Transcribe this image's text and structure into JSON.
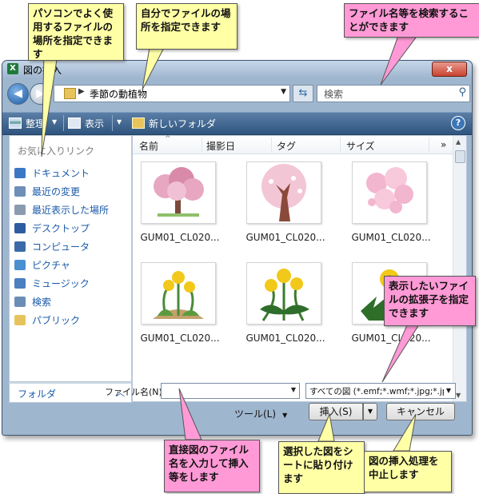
{
  "window": {
    "title": "図の挿入",
    "app_icon": "X",
    "close_label": "x",
    "address": {
      "path": "季節の動植物",
      "separator": "▶"
    },
    "search": {
      "placeholder": "検索"
    },
    "toolbar": {
      "organize_label": "整理",
      "views_label": "表示",
      "new_folder_label": "新しいフォルダ",
      "help_label": "?"
    },
    "favorites": {
      "heading": "お気に入りリンク",
      "items": [
        {
          "label": "ドキュメント",
          "icon": "documents-icon",
          "color": "#3a78c4"
        },
        {
          "label": "最近の変更",
          "icon": "recent-changes-icon",
          "color": "#6d8fb8"
        },
        {
          "label": "最近表示した場所",
          "icon": "recent-places-icon",
          "color": "#8a9bb0"
        },
        {
          "label": "デスクトップ",
          "icon": "desktop-icon",
          "color": "#2d5da0"
        },
        {
          "label": "コンピュータ",
          "icon": "computer-icon",
          "color": "#3c6aa8"
        },
        {
          "label": "ピクチャ",
          "icon": "pictures-icon",
          "color": "#4a8fd0"
        },
        {
          "label": "ミュージック",
          "icon": "music-icon",
          "color": "#4a7fc0"
        },
        {
          "label": "検索",
          "icon": "search-folder-icon",
          "color": "#6b8db5"
        },
        {
          "label": "パブリック",
          "icon": "public-folder-icon",
          "color": "#e7c45b"
        }
      ],
      "folders_label": "フォルダ",
      "folders_chevron": "︿"
    },
    "columns": [
      "名前",
      "撮影日",
      "タグ",
      "サイズ"
    ],
    "columns_more": "»",
    "files": [
      {
        "label": "GUM01_CL020...",
        "icon": "cherry-tree-clipart"
      },
      {
        "label": "GUM01_CL020...",
        "icon": "cherry-tree-pink-clipart"
      },
      {
        "label": "GUM01_CL020...",
        "icon": "cherry-blossom-clipart"
      },
      {
        "label": "GUM01_CL020...",
        "icon": "dandelion-yellow-clipart"
      },
      {
        "label": "GUM01_CL020...",
        "icon": "dandelion-plant-clipart"
      },
      {
        "label": "GUM01_CL020...",
        "icon": "dandelion-leaf-clipart"
      }
    ],
    "filename_label": "ファイル名(N):",
    "filename_value": "",
    "filetype_value": "すべての図 (*.emf;*.wmf;*.jpg;*.jpe",
    "tools_label": "ツール(L)",
    "insert_label": "挿入(S)",
    "cancel_label": "キャンセル"
  },
  "callouts": {
    "sidebar": "パソコンでよく使用するファイルの場所を指定できます",
    "location": "自分でファイルの場所を指定できます",
    "search": "ファイル名等を検索することができます",
    "filetype": "表示したいファイルの拡張子を指定できます",
    "filename": "直接図のファイル名を入力して挿入等をします",
    "insert": "選択した図をシートに貼り付けます",
    "cancel": "図の挿入処理を中止します"
  },
  "colors": {
    "yellow_callout": "#ffffa6",
    "pink_callout": "#ff9ad6",
    "toolbar": "#3f6690",
    "link_text": "#1a5aa8"
  }
}
